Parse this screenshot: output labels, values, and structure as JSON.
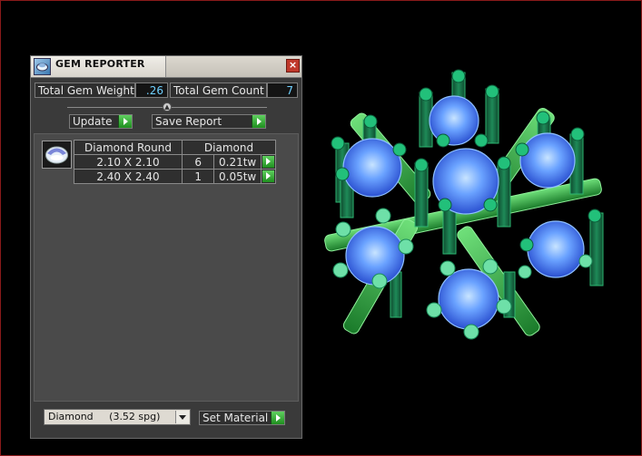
{
  "window": {
    "title": "GEM REPORTER",
    "close_icon": "close-icon",
    "app_icon": "gem-reporter-icon"
  },
  "summary": {
    "total_weight_label": "Total Gem Weight",
    "total_weight_value": ".26",
    "total_count_label": "Total Gem Count",
    "total_count_value": "7"
  },
  "toolbar": {
    "update_label": "Update",
    "save_report_label": "Save Report"
  },
  "gem_table": {
    "headers": [
      "Diamond Round",
      "Diamond"
    ],
    "rows": [
      {
        "size": "2.10 X 2.10",
        "count": "6",
        "weight": "0.21tw"
      },
      {
        "size": "2.40 X 2.40",
        "count": "1",
        "weight": "0.05tw"
      }
    ],
    "thumbnail_icon": "round-gem-icon"
  },
  "footer": {
    "material_selected": "Diamond     (3.52 spg)",
    "set_material_label": "Set Material"
  },
  "colors": {
    "accent_green": "#2fae2f",
    "value_text": "#6fd0ff",
    "close_red": "#c0392b",
    "viewport_border": "#8a1a1a"
  }
}
